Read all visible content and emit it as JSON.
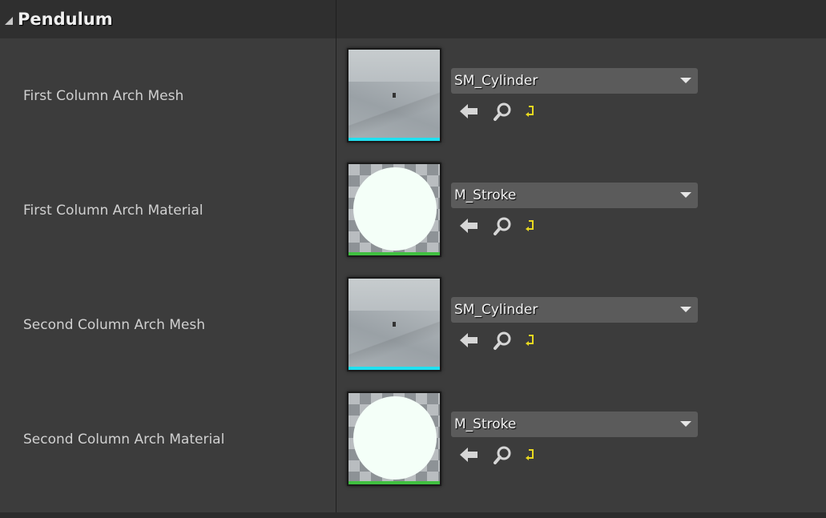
{
  "section": {
    "title": "Pendulum",
    "collapse_icon": "triangle-expanded-icon"
  },
  "properties": [
    {
      "label": "First Column Arch Mesh",
      "value": "SM_Cylinder",
      "thumb_type": "mesh",
      "thumb_bar_color": "#20e0f0"
    },
    {
      "label": "First Column Arch Material",
      "value": "M_Stroke",
      "thumb_type": "material",
      "thumb_bar_color": "#40c040"
    },
    {
      "label": "Second Column Arch Mesh",
      "value": "SM_Cylinder",
      "thumb_type": "mesh",
      "thumb_bar_color": "#20e0f0"
    },
    {
      "label": "Second Column Arch Material",
      "value": "M_Stroke",
      "thumb_type": "material",
      "thumb_bar_color": "#40c040"
    }
  ],
  "icons": {
    "use_selected": "arrow-left-icon",
    "browse": "magnifier-icon",
    "reset": "reset-arrow-icon"
  },
  "colors": {
    "background": "#3c3c3c",
    "header": "#2f2f2f",
    "dropdown": "#5b5b5b",
    "reset_icon": "#e8d820"
  }
}
